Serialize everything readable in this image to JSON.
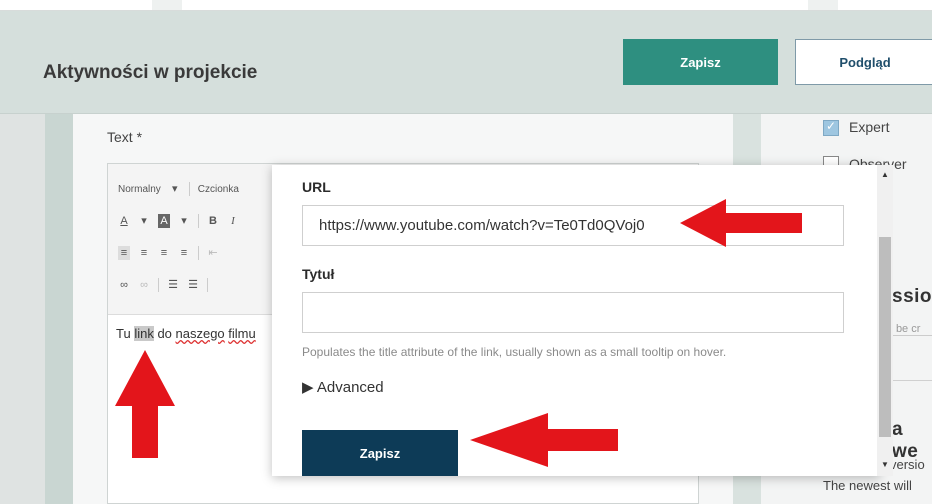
{
  "header": {
    "title": "Aktywności w projekcie",
    "save_label": "Zapisz",
    "preview_label": "Podgląd"
  },
  "editor": {
    "field_label": "Text *",
    "toolbar": {
      "style_select": "Normalny",
      "font_select": "Czcionka"
    },
    "content": {
      "part1": "Tu ",
      "link_word": "link",
      "part2": " do ",
      "word3": "naszego",
      "word4": "filmu"
    }
  },
  "right": {
    "expert_label": "Expert",
    "observer_label": "Observer",
    "heading1": "ssio",
    "hint1": "ll be cr",
    "heading2": "a we",
    "version_text": "versio",
    "newest_text": "The newest will"
  },
  "modal": {
    "url_label": "URL",
    "url_value": "https://www.youtube.com/watch?v=Te0Td0QVoj0",
    "title_label": "Tytuł",
    "title_value": "",
    "help_text": "Populates the title attribute of the link, usually shown as a small tooltip on hover.",
    "advanced_label": "▶ Advanced",
    "save_label": "Zapisz"
  },
  "colors": {
    "accent": "#2e8f80",
    "primary_dark": "#0d3b57",
    "annotation_arrow": "#e3151b"
  }
}
